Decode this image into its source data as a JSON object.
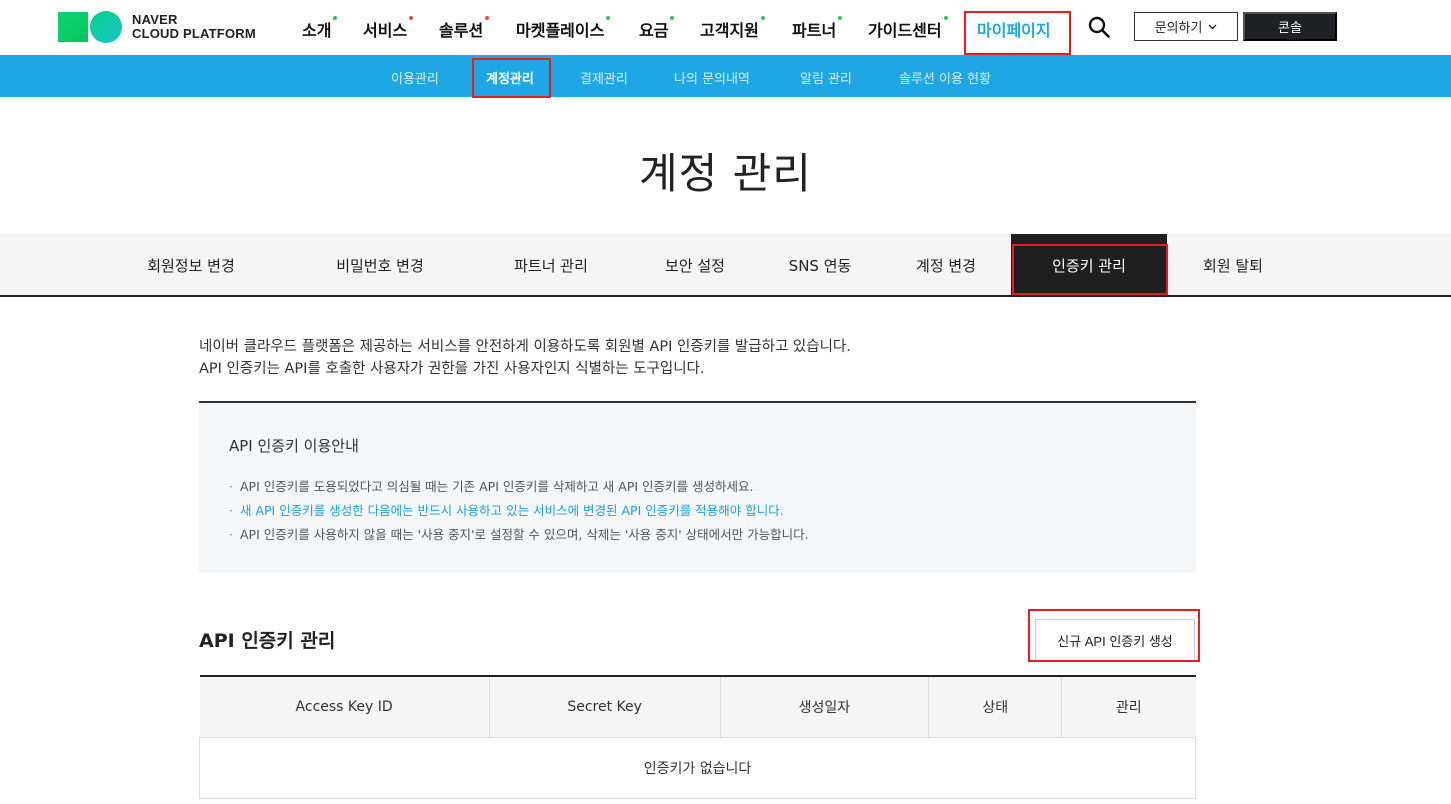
{
  "header": {
    "logo": {
      "line1": "NAVER",
      "line2": "CLOUD PLATFORM"
    },
    "nav": [
      {
        "label": "소개",
        "dot": "#2fc35a"
      },
      {
        "label": "서비스",
        "dot": "#f04b3a"
      },
      {
        "label": "솔루션",
        "dot": "#f04b3a"
      },
      {
        "label": "마켓플레이스",
        "dot": "#2fc35a"
      },
      {
        "label": "요금",
        "dot": "#2fc35a"
      },
      {
        "label": "고객지원",
        "dot": "#2fc35a"
      },
      {
        "label": "파트너",
        "dot": "#2fc35a"
      },
      {
        "label": "가이드센터",
        "dot": "#2fc35a"
      },
      {
        "label": "마이페이지",
        "dot": ""
      }
    ],
    "search_icon": "search-icon",
    "inquiry_label": "문의하기",
    "console_label": "콘솔"
  },
  "subnav": {
    "items": [
      "이용관리",
      "계정관리",
      "결제관리",
      "나의 문의내역",
      "알림 관리",
      "솔루션 이용 현황"
    ],
    "active": "계정관리"
  },
  "page": {
    "title": "계정 관리"
  },
  "tabs": {
    "items": [
      "회원정보 변경",
      "비밀번호 변경",
      "파트너 관리",
      "보안 설정",
      "SNS 연동",
      "계정 변경",
      "인증키 관리",
      "회원 탈퇴"
    ],
    "active": "인증키 관리"
  },
  "description": {
    "line1": "네이버 클라우드 플랫폼은 제공하는 서비스를 안전하게 이용하도록 회원별 API 인증키를 발급하고 있습니다.",
    "line2": "API 인증키는 API를 호출한 사용자가 권한을 가진 사용자인지 식별하는 도구입니다."
  },
  "info": {
    "title": "API 인증키 이용안내",
    "bullet": "·",
    "items": [
      "API 인증키를 도용되었다고 의심될 때는 기존 API 인증키를 삭제하고 새 API 인증키를 생성하세요.",
      "새 API 인증키를 생성한 다음에는 반드시 사용하고 있는 서비스에 변경된 API 인증키를 적용해야 합니다.",
      "API 인증키를 사용하지 않을 때는 '사용 중지'로 설정할 수 있으며, 삭제는 '사용 중지' 상태에서만 가능합니다."
    ],
    "highlight_color": "#1f9fe0"
  },
  "section": {
    "title": "API 인증키 관리",
    "new_key_button": "신규 API 인증키 생성"
  },
  "table": {
    "headers": [
      "Access Key ID",
      "Secret Key",
      "생성일자",
      "상태",
      "관리"
    ],
    "empty_message": "인증키가 없습니다"
  },
  "colors": {
    "accent": "#1ea7e4",
    "highlight_box": "#e41e1e",
    "active_tab_bg": "#1f1f1f"
  }
}
